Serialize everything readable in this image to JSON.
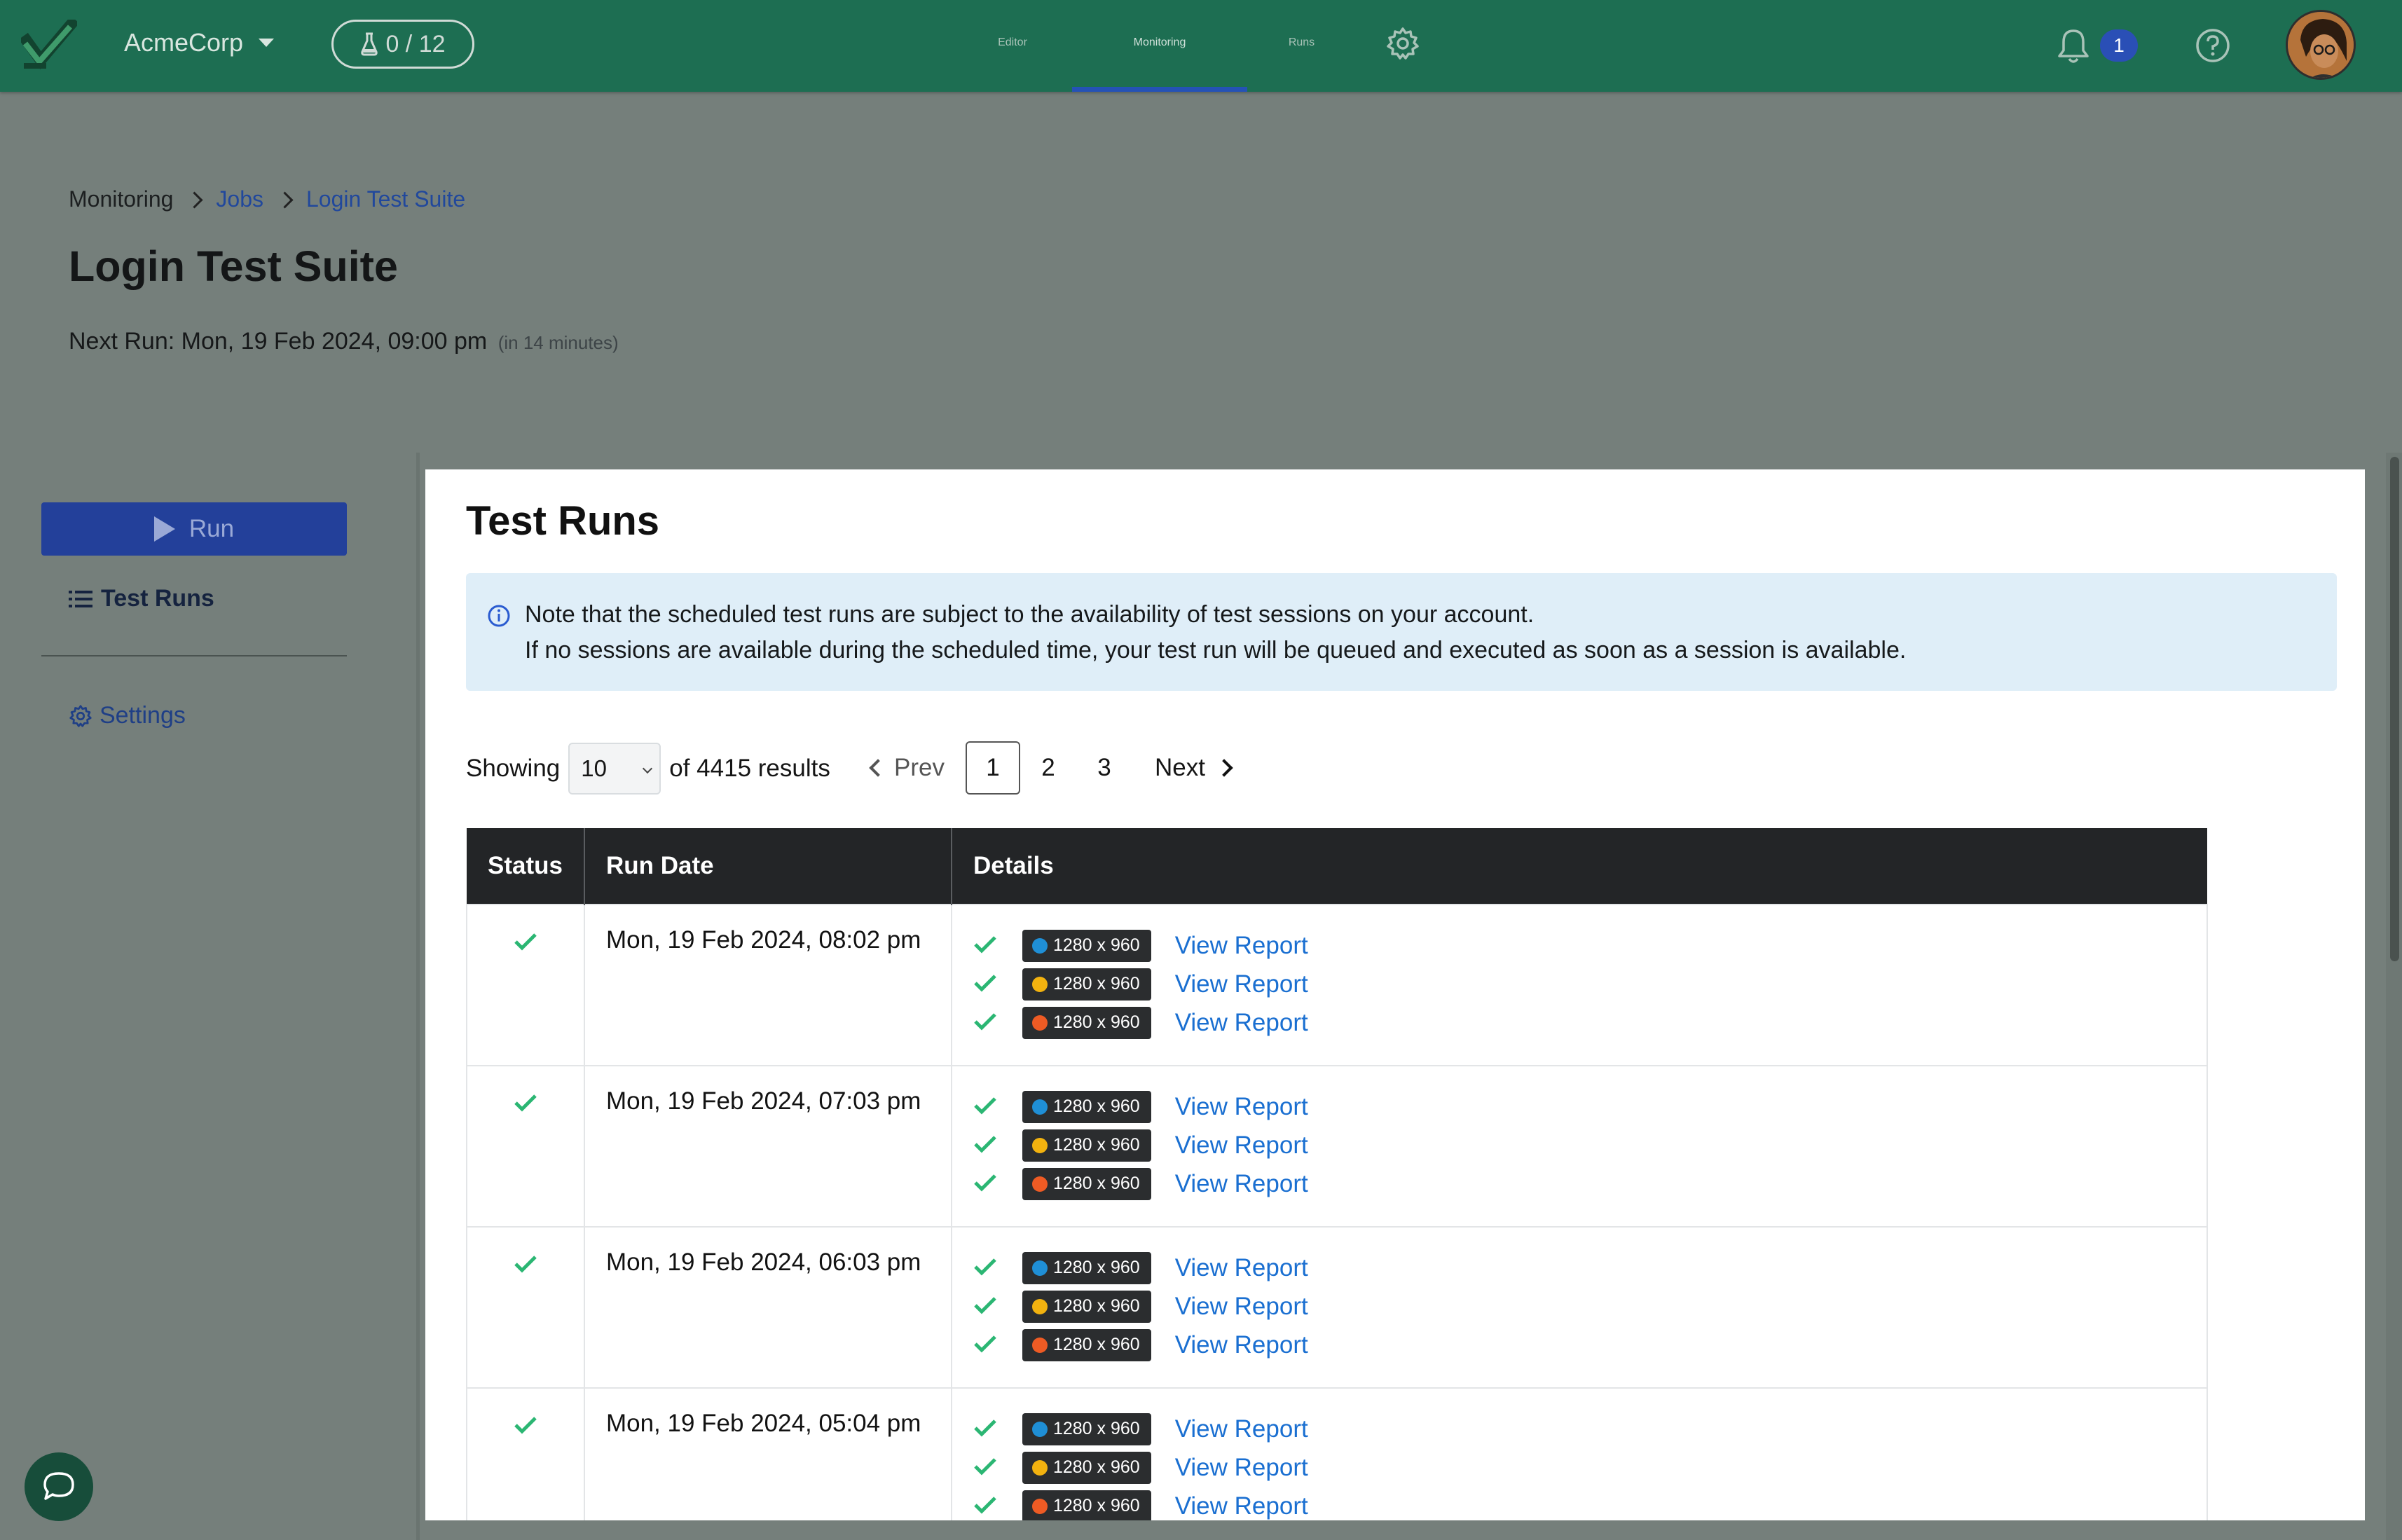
{
  "header": {
    "org_name": "AcmeCorp",
    "quota": "0 / 12",
    "nav": [
      {
        "label": "Editor"
      },
      {
        "label": "Monitoring"
      },
      {
        "label": "Runs"
      }
    ],
    "notifications_count": "1"
  },
  "breadcrumb": [
    "Monitoring",
    "Jobs",
    "Login Test Suite"
  ],
  "page": {
    "title": "Login Test Suite",
    "next_run_label": "Next Run: Mon, 19 Feb 2024, 09:00 pm",
    "next_run_relative": "(in 14 minutes)"
  },
  "sidebar": {
    "run_label": "Run",
    "test_runs_label": "Test Runs",
    "settings_label": "Settings"
  },
  "panel": {
    "title": "Test Runs",
    "note_line1": "Note that the scheduled test runs are subject to the availability of test sessions on your account.",
    "note_line2": "If no sessions are available during the scheduled time, your test run will be queued and executed as soon as a session is available.",
    "showing_label": "Showing",
    "page_size": "10",
    "results_label": "of 4415 results",
    "prev_label": "Prev",
    "next_label": "Next",
    "pages": [
      "1",
      "2",
      "3"
    ],
    "current_page": "1"
  },
  "table": {
    "headers": [
      "Status",
      "Run Date",
      "Details"
    ],
    "rows": [
      {
        "date": "Mon, 19 Feb 2024, 08:02 pm"
      },
      {
        "date": "Mon, 19 Feb 2024, 07:03 pm"
      },
      {
        "date": "Mon, 19 Feb 2024, 06:03 pm"
      },
      {
        "date": "Mon, 19 Feb 2024, 05:04 pm"
      }
    ],
    "detail_items": [
      {
        "browser": "edge",
        "resolution": "1280 x 960",
        "link": "View Report"
      },
      {
        "browser": "chrome",
        "resolution": "1280 x 960",
        "link": "View Report"
      },
      {
        "browser": "firefox",
        "resolution": "1280 x 960",
        "link": "View Report"
      }
    ]
  },
  "colors": {
    "header_bg": "#1d6e52",
    "accent_blue": "#23409a",
    "success_green": "#2bb673",
    "link_blue": "#1a6fd1"
  }
}
